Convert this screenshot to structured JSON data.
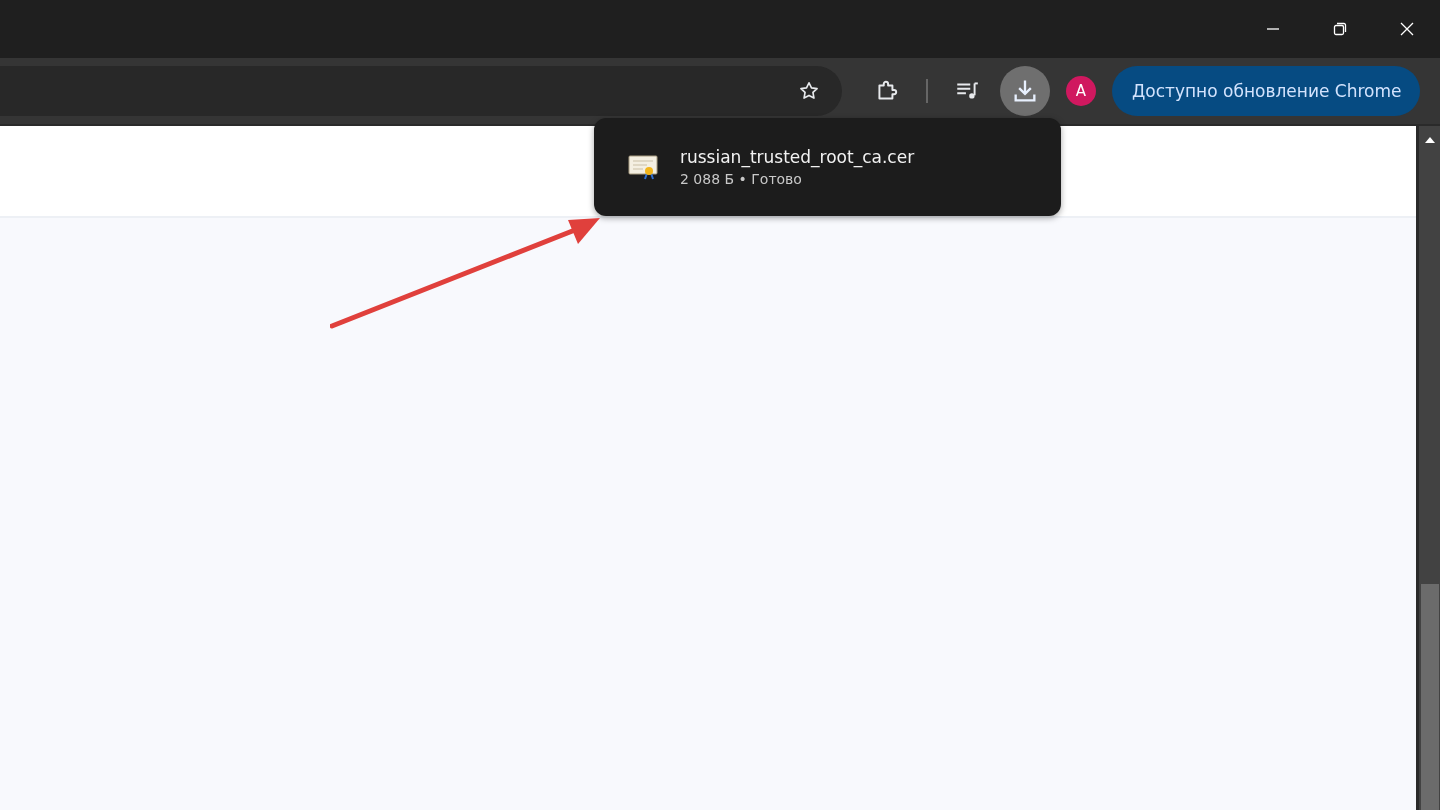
{
  "toolbar": {
    "download_button_active": true,
    "avatar_letter": "A",
    "update_button": {
      "label": "Доступно обновление Chrome"
    }
  },
  "download_popup": {
    "items": [
      {
        "file_name": "russian_trusted_root_ca.cer",
        "status": "2 088 Б • Готово"
      }
    ]
  },
  "annotation": {
    "kind": "arrow"
  }
}
